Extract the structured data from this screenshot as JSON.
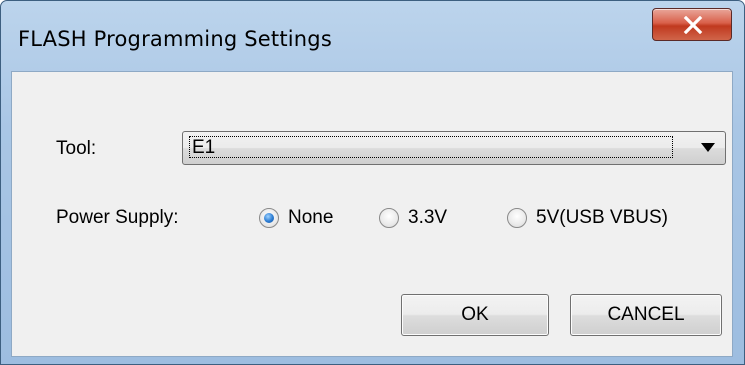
{
  "window": {
    "title": "FLASH Programming Settings"
  },
  "tool": {
    "label": "Tool:",
    "selected_value": "E1"
  },
  "power_supply": {
    "label": "Power Supply:",
    "options": [
      {
        "label": "None",
        "checked": true
      },
      {
        "label": "3.3V",
        "checked": false
      },
      {
        "label": "5V(USB VBUS)",
        "checked": false
      }
    ]
  },
  "buttons": {
    "ok_label": "OK",
    "cancel_label": "CANCEL"
  },
  "icons": {
    "close": "close-icon",
    "dropdown": "chevron-down-icon"
  },
  "colors": {
    "title_bar": "#a9c6e5",
    "close_button": "#c0391f",
    "client_area": "#f0f0f0",
    "radio_selected": "#2b7cd3"
  }
}
